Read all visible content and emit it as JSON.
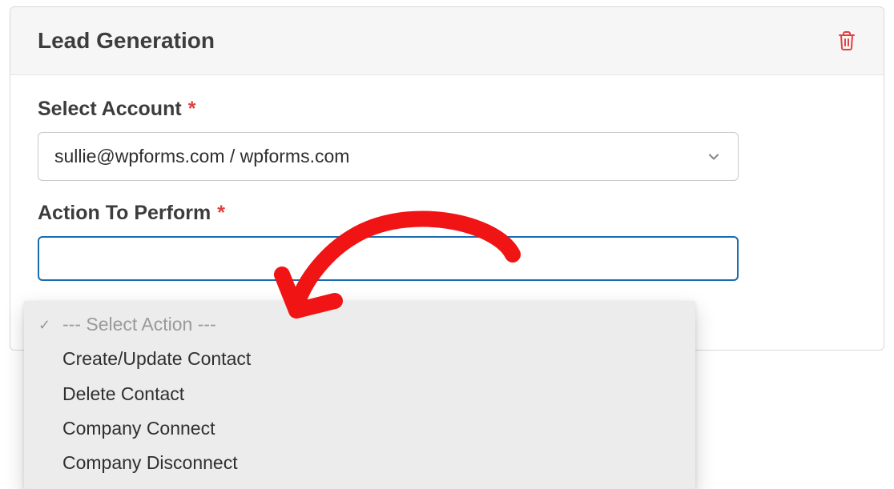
{
  "panel": {
    "title": "Lead Generation"
  },
  "select_account": {
    "label": "Select Account",
    "required_mark": "*",
    "value": "sullie@wpforms.com / wpforms.com"
  },
  "action_to_perform": {
    "label": "Action To Perform",
    "required_mark": "*",
    "placeholder": "--- Select Action ---",
    "options": [
      "Create/Update Contact",
      "Delete Contact",
      "Company Connect",
      "Company Disconnect"
    ]
  },
  "colors": {
    "accent_border": "#1a6bb0",
    "required": "#e23f3f",
    "trash": "#e23f3f",
    "arrow": "#f01414"
  }
}
